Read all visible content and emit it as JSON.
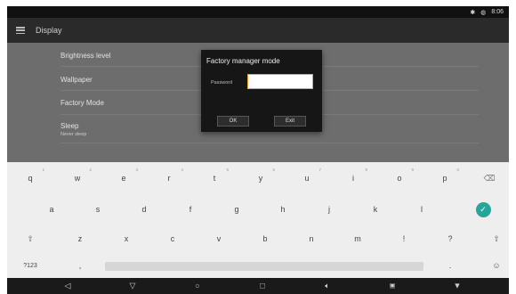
{
  "status_bar": {
    "time": "8:06",
    "status_icons": [
      "bluetooth-icon",
      "wifi-icon"
    ]
  },
  "app_bar": {
    "title": "Display",
    "menu_icon": "menu-icon"
  },
  "settings": [
    {
      "label": "Brightness level",
      "sub": ""
    },
    {
      "label": "Wallpaper",
      "sub": ""
    },
    {
      "label": "Factory Mode",
      "sub": ""
    },
    {
      "label": "Sleep",
      "sub": "Never sleep"
    }
  ],
  "dialog": {
    "title": "Factory manager mode",
    "password_label": "Password",
    "password_value": "",
    "ok_label": "OK",
    "exit_label": "Exit",
    "accent_color": "#f0a030"
  },
  "keyboard": {
    "row1": [
      {
        "key": "q",
        "sup": "1"
      },
      {
        "key": "w",
        "sup": "2"
      },
      {
        "key": "e",
        "sup": "3"
      },
      {
        "key": "r",
        "sup": "4"
      },
      {
        "key": "t",
        "sup": "5"
      },
      {
        "key": "y",
        "sup": "6"
      },
      {
        "key": "u",
        "sup": "7"
      },
      {
        "key": "i",
        "sup": "8"
      },
      {
        "key": "o",
        "sup": "9"
      },
      {
        "key": "p",
        "sup": "0"
      },
      {
        "key": "⌫",
        "sup": ""
      }
    ],
    "row2": [
      "a",
      "s",
      "d",
      "f",
      "g",
      "h",
      "j",
      "k",
      "l",
      "✓"
    ],
    "row3": [
      "⇧",
      "z",
      "x",
      "c",
      "v",
      "b",
      "n",
      "m",
      "!",
      "?",
      "⇧"
    ],
    "row4": {
      "symbols": "?123",
      "comma": ",",
      "period": ".",
      "emoji": "☺"
    }
  },
  "nav_bar": {
    "icons": [
      "back-icon",
      "home-icon",
      "recents-icon",
      "volume-icon",
      "screenshot-icon",
      "keyboard-hide-icon"
    ]
  }
}
